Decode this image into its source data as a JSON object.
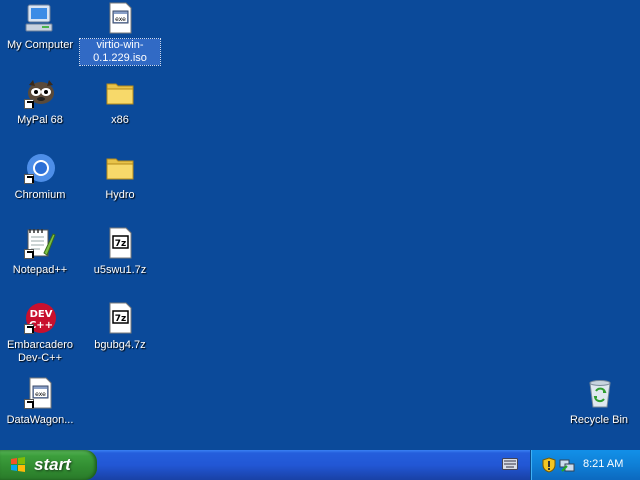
{
  "desktop": {
    "icons": [
      {
        "label": "My Computer",
        "icon": "my-computer-icon"
      },
      {
        "label": "virtio-win-0.1.229.iso",
        "icon": "iso-file-icon"
      },
      {
        "label": "MyPal 68",
        "icon": "mypal-icon"
      },
      {
        "label": "x86",
        "icon": "folder-icon"
      },
      {
        "label": "Chromium",
        "icon": "chromium-icon"
      },
      {
        "label": "Hydro",
        "icon": "folder-icon"
      },
      {
        "label": "Notepad++",
        "icon": "notepad-plus-plus-icon"
      },
      {
        "label": "u5swu1.7z",
        "icon": "7z-file-icon"
      },
      {
        "label": "Embarcadero Dev-C++",
        "icon": "dev-cpp-icon"
      },
      {
        "label": "bgubg4.7z",
        "icon": "7z-file-icon"
      },
      {
        "label": "DataWagon...",
        "icon": "datawagon-icon"
      },
      {
        "label": "Recycle Bin",
        "icon": "recycle-bin-icon"
      }
    ],
    "selected": "virtio-win-0.1.229.iso"
  },
  "taskbar": {
    "start_label": "start",
    "clock": "8:21 AM",
    "tray_icons": [
      "security-shield-icon",
      "network-icon"
    ],
    "colors": {
      "taskbar": "#245edc",
      "start": "#3c9e3c",
      "tray": "#0f7fd6",
      "desktop": "#0b4a9a"
    }
  }
}
